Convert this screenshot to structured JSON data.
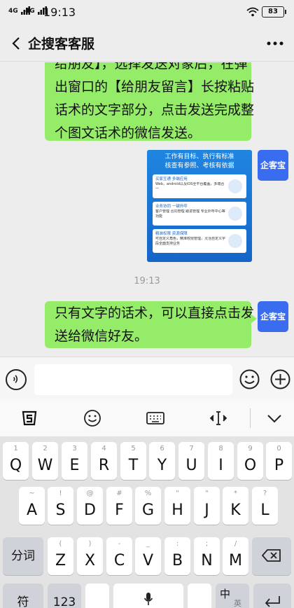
{
  "status_bar": {
    "signal1": "4G",
    "signal2": "4G",
    "time": "19:13",
    "battery": "83"
  },
  "header": {
    "title": "企搜客客服"
  },
  "chat": {
    "msg1_lines": [
      "给朋友】，选择发送对象后，在弹",
      "出窗口的【给朋友留言】长按粘贴",
      "话术的文字部分，点击发送完成整",
      "个图文话术的微信发送。"
    ],
    "card": {
      "heading_lines": [
        "工作有目标、执行有标准",
        "核查有参照、考核有依据"
      ],
      "features": [
        {
          "title": "买家互通 多端应用",
          "desc": "Web，android以及iOS全平台覆盖，多端合一"
        },
        {
          "title": "业务协同 一键外呼",
          "desc": "客户管理 合同管理 跟进管理 专业外呼中心等功能"
        },
        {
          "title": "精准权限 资源保障",
          "desc": "可自定义角色，精准权限管理，灵活自定义字段全面支持业务"
        }
      ]
    },
    "timestamp": "19:13",
    "msg2_lines": [
      "只有文字的话术，可以直接点击发",
      "送给微信好友。"
    ],
    "avatar_label": "企客宝"
  },
  "keyboard": {
    "row1": [
      {
        "hint": "1",
        "key": "Q"
      },
      {
        "hint": "2",
        "key": "W"
      },
      {
        "hint": "3",
        "key": "E"
      },
      {
        "hint": "4",
        "key": "R"
      },
      {
        "hint": "5",
        "key": "T"
      },
      {
        "hint": "6",
        "key": "Y"
      },
      {
        "hint": "7",
        "key": "U"
      },
      {
        "hint": "8",
        "key": "I"
      },
      {
        "hint": "9",
        "key": "O"
      },
      {
        "hint": "0",
        "key": "P"
      }
    ],
    "row2": [
      {
        "hint": "~",
        "key": "A"
      },
      {
        "hint": "!",
        "key": "S"
      },
      {
        "hint": "@",
        "key": "D"
      },
      {
        "hint": "#",
        "key": "F"
      },
      {
        "hint": "%",
        "key": "G"
      },
      {
        "hint": "\"",
        "key": "H"
      },
      {
        "hint": "\"",
        "key": "J"
      },
      {
        "hint": "*",
        "key": "K"
      },
      {
        "hint": "?",
        "key": "L"
      }
    ],
    "row3_left": "分词",
    "row3": [
      {
        "hint": "(",
        "key": "Z"
      },
      {
        "hint": ")",
        "key": "X"
      },
      {
        "hint": "-",
        "key": "C"
      },
      {
        "hint": "_",
        "key": "V"
      },
      {
        "hint": ":",
        "key": "B"
      },
      {
        "hint": ";",
        "key": "N"
      },
      {
        "hint": "/",
        "key": "M"
      }
    ],
    "row4_sym": "符",
    "row4_num": "123",
    "row4_lang": "中",
    "row4_lang_sub": "英"
  },
  "colors": {
    "bubble": "#95ec69",
    "avatar": "#3a6cf0",
    "card": "#1f86e0"
  }
}
